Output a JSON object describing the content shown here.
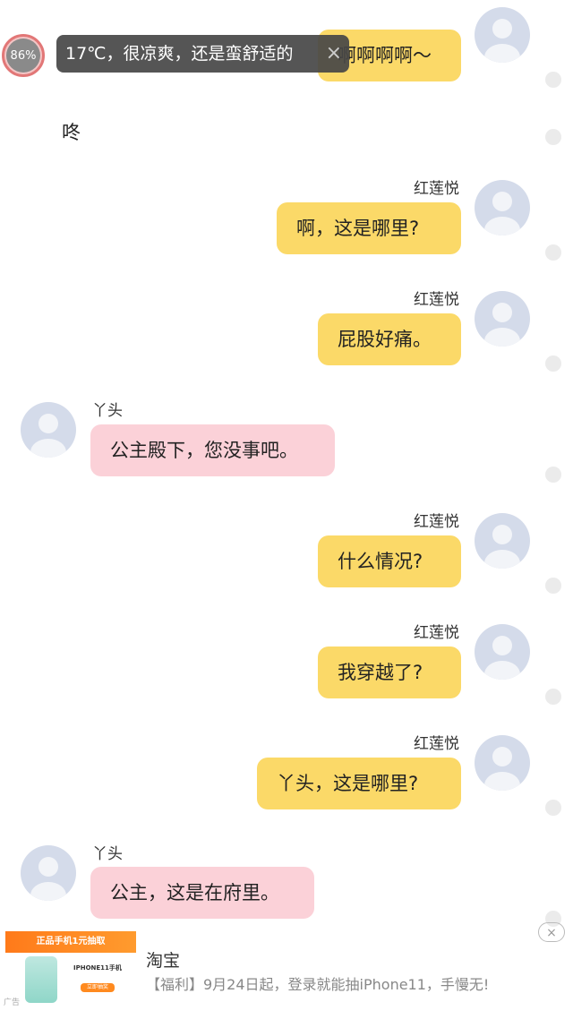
{
  "overlay": {
    "battery_text": "86%",
    "battery_level": 0.86,
    "toast_text": "17℃，很凉爽，还是蛮舒适的",
    "toast_close": "×"
  },
  "narration": "咚",
  "messages": [
    {
      "side": "right",
      "sender": "",
      "text": "啊啊啊啊～"
    },
    {
      "side": "right",
      "sender": "红莲悦",
      "text": "啊，这是哪里?"
    },
    {
      "side": "right",
      "sender": "红莲悦",
      "text": "屁股好痛。"
    },
    {
      "side": "left",
      "sender": "丫头",
      "text": "公主殿下，您没事吧。"
    },
    {
      "side": "right",
      "sender": "红莲悦",
      "text": "什么情况?"
    },
    {
      "side": "right",
      "sender": "红莲悦",
      "text": "我穿越了?"
    },
    {
      "side": "right",
      "sender": "红莲悦",
      "text": "丫头，这是哪里?"
    },
    {
      "side": "left",
      "sender": "丫头",
      "text": "公主，这是在府里。"
    }
  ],
  "ad": {
    "title": "淘宝",
    "description": "【福利】9月24日起，登录就能抽iPhone11，手慢无!",
    "banner_text": "正品手机1元抽取",
    "phone_text": "IPHONE11手机",
    "button_text": "立即抽奖",
    "label": "广告",
    "close": "×"
  },
  "colors": {
    "right_bubble": "#fbd968",
    "left_bubble": "#fbd1d8",
    "avatar_bg": "#d4dbea"
  }
}
